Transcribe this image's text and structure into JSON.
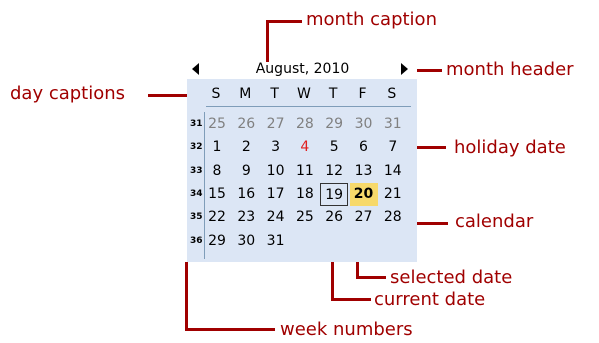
{
  "calendar": {
    "title": "August, 2010",
    "day_captions": [
      "S",
      "M",
      "T",
      "W",
      "T",
      "F",
      "S"
    ],
    "week_numbers": [
      "31",
      "32",
      "33",
      "34",
      "35",
      "36"
    ],
    "weeks": [
      [
        "25",
        "26",
        "27",
        "28",
        "29",
        "30",
        "31"
      ],
      [
        "1",
        "2",
        "3",
        "4",
        "5",
        "6",
        "7"
      ],
      [
        "8",
        "9",
        "10",
        "11",
        "12",
        "13",
        "14"
      ],
      [
        "15",
        "16",
        "17",
        "18",
        "19",
        "20",
        "21"
      ],
      [
        "22",
        "23",
        "24",
        "25",
        "26",
        "27",
        "28"
      ],
      [
        "29",
        "30",
        "31",
        "",
        "",
        "",
        ""
      ]
    ],
    "other_month_week": 0,
    "holiday_date": "4",
    "current_date": "19",
    "selected_date": "20",
    "colors": {
      "background": "#dce6f5",
      "selected": "#f7d96b",
      "holiday": "#e02020",
      "annotation": "#a00000",
      "other_month": "#808080"
    }
  },
  "annotations": {
    "month_caption": "month caption",
    "month_header": "month header",
    "day_captions": "day captions",
    "holiday_date": "holiday date",
    "calendar": "calendar",
    "selected_date": "selected date",
    "current_date": "current date",
    "week_numbers": "week numbers"
  }
}
